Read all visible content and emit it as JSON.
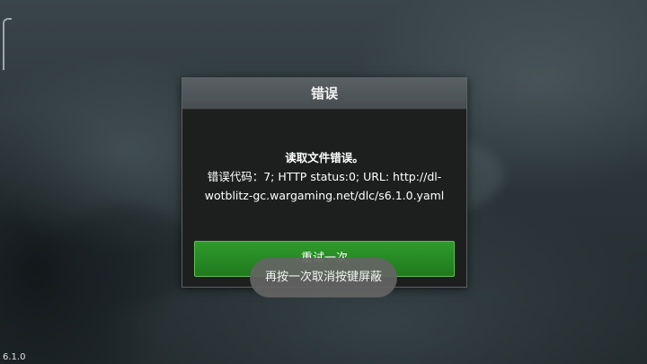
{
  "dialog": {
    "title": "错误",
    "message_line1": "读取文件错误。",
    "message_line2": "错误代码：7; HTTP status:0; URL: http://dl-",
    "message_line3": "wotblitz-gc.wargaming.net/dlc/s6.1.0.yaml",
    "retry_label": "重试一次"
  },
  "toast": {
    "text": "再按一次取消按键屏蔽"
  },
  "version": "6.1.0",
  "colors": {
    "dialog_bg": "#1d1f1f",
    "header_bg": "#51585b",
    "button_green": "#268a24",
    "toast_bg": "#646464"
  }
}
